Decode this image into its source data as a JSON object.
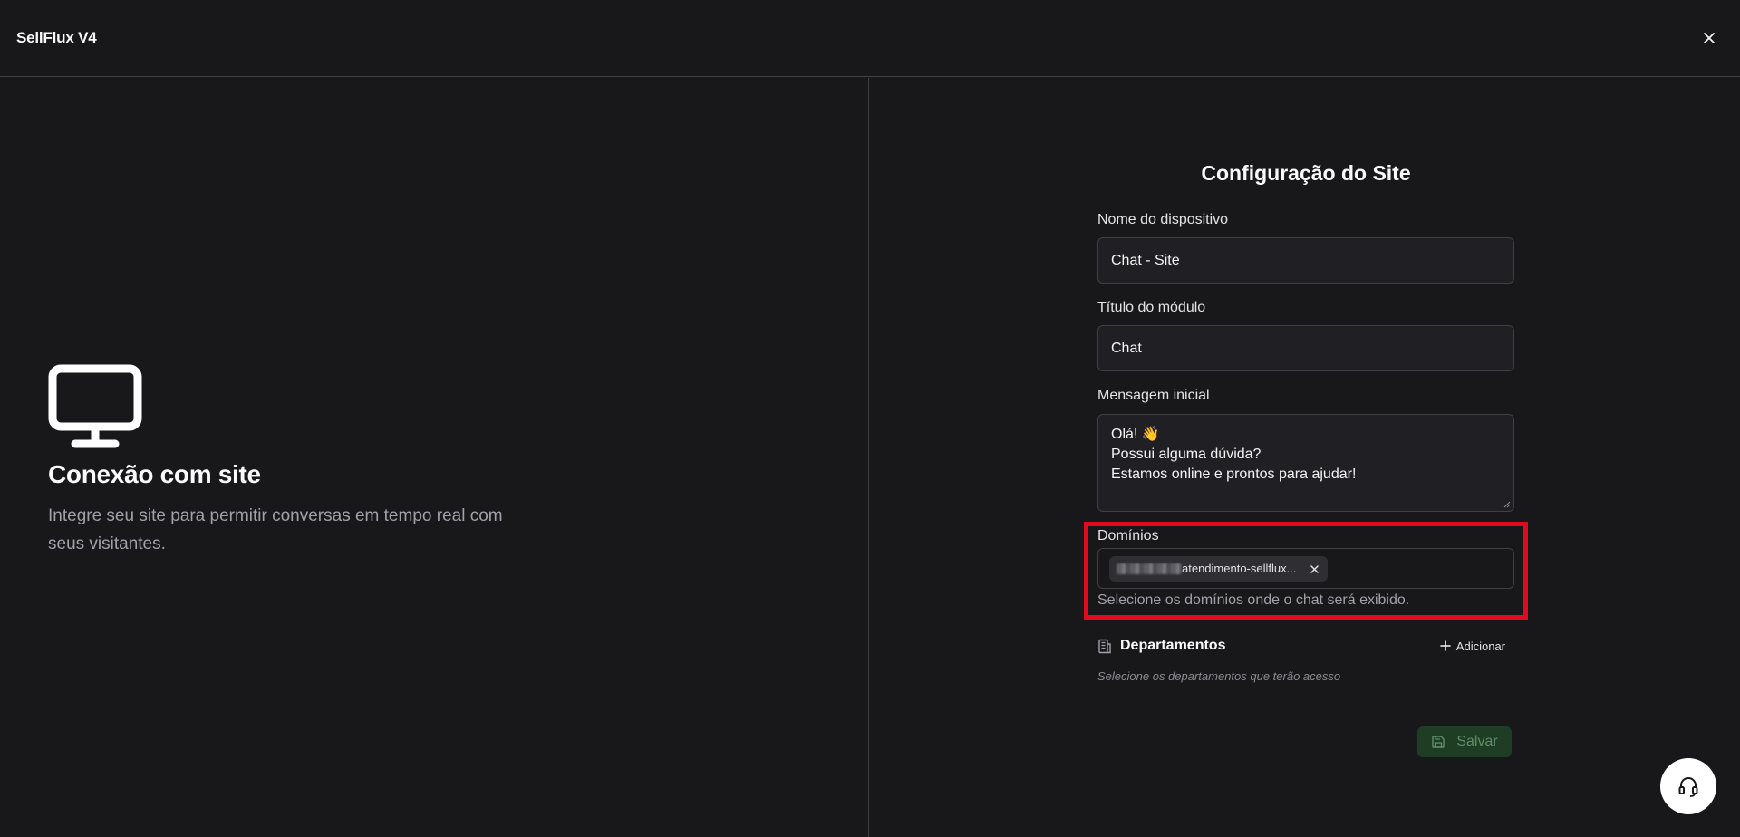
{
  "header": {
    "app_title": "SellFlux V4",
    "close_label": "×"
  },
  "left": {
    "icon": "monitor-icon",
    "title": "Conexão com site",
    "description": "Integre seu site para permitir conversas em tempo real com seus visitantes."
  },
  "form": {
    "title": "Configuração do Site",
    "device_name": {
      "label": "Nome do dispositivo",
      "value": "Chat - Site"
    },
    "module_title": {
      "label": "Título do módulo",
      "value": "Chat"
    },
    "initial_message": {
      "label": "Mensagem inicial",
      "lines": [
        "Olá! 👋",
        "Possui alguma dúvida?",
        "Estamos online e prontos para ajudar!"
      ]
    },
    "domains": {
      "label": "Domínios",
      "chips": [
        {
          "text": "atendimento-sellflux..."
        }
      ],
      "help": "Selecione os domínios onde o chat será exibido."
    },
    "departments": {
      "title": "Departamentos",
      "add_label": "Adicionar",
      "hint": "Selecione os departamentos que terão acesso"
    },
    "save_label": "Salvar"
  },
  "colors": {
    "background": "#18181b",
    "highlight": "#e00b1f",
    "save_bg": "#1f3d25",
    "save_text": "#5f8f68"
  },
  "support": {
    "icon": "headset-icon"
  }
}
